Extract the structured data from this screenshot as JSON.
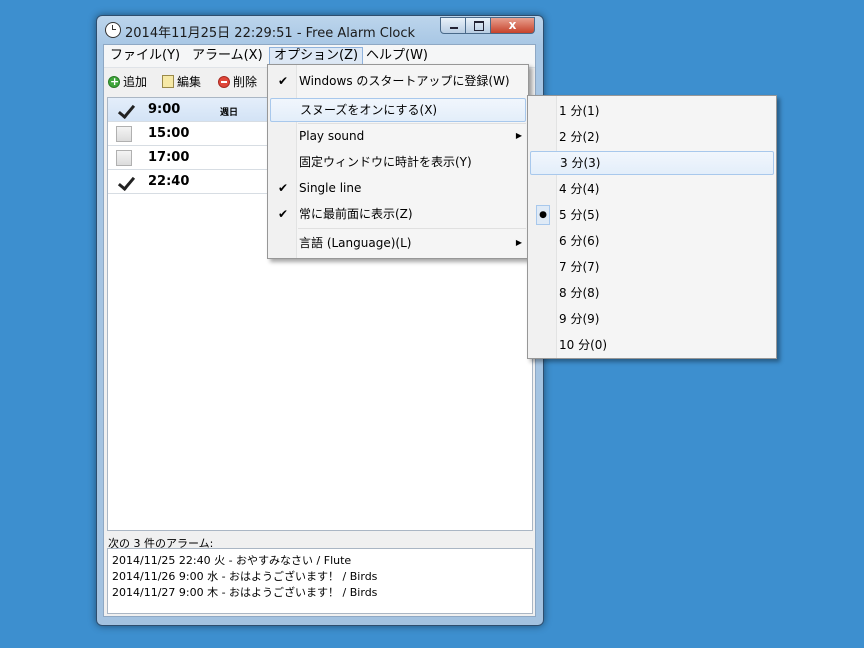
{
  "window": {
    "title": "2014年11月25日 22:29:51 - Free Alarm Clock",
    "close_label": "x"
  },
  "menubar": [
    {
      "label": "ファイル(Y)"
    },
    {
      "label": "アラーム(X)"
    },
    {
      "label": "オプション(Z)",
      "active": true
    },
    {
      "label": "ヘルプ(W)"
    }
  ],
  "toolbar": {
    "add_label": "追加",
    "edit_label": "編集",
    "delete_label": "削除"
  },
  "alarms": [
    {
      "time": "9:00",
      "enabled": true,
      "repeat": "週日",
      "selected": true
    },
    {
      "time": "15:00",
      "enabled": false,
      "repeat": ""
    },
    {
      "time": "17:00",
      "enabled": false,
      "repeat": ""
    },
    {
      "time": "22:40",
      "enabled": true,
      "repeat": ""
    }
  ],
  "next_alarms": {
    "label": "次の 3 件のアラーム:",
    "items": [
      "2014/11/25 22:40 火 - おやすみなさい / Flute",
      "2014/11/26 9:00 水 - おはようございます！ / Birds",
      "2014/11/27 9:00 木 - おはようございます！ / Birds"
    ]
  },
  "options_menu": [
    {
      "label": "Windows のスタートアップに登録(W)",
      "checked": true
    },
    {
      "label": "スヌーズをオンにする(X)",
      "checked": false,
      "highlighted": true
    },
    {
      "label": "Play sound",
      "submenu": true
    },
    {
      "label": "固定ウィンドウに時計を表示(Y)"
    },
    {
      "label": "Single line",
      "checked": true
    },
    {
      "label": "常に最前面に表示(Z)",
      "checked": true
    },
    {
      "label": "言語 (Language)(L)",
      "submenu": true
    }
  ],
  "snooze_submenu": [
    {
      "label": "1 分(1)"
    },
    {
      "label": "2 分(2)"
    },
    {
      "label": "3 分(3)",
      "highlighted": true
    },
    {
      "label": "4 分(4)"
    },
    {
      "label": "5 分(5)",
      "selected": true
    },
    {
      "label": "6 分(6)"
    },
    {
      "label": "7 分(7)"
    },
    {
      "label": "8 分(8)"
    },
    {
      "label": "9 分(9)"
    },
    {
      "label": "10 分(0)"
    }
  ],
  "icons": {
    "check": "✔",
    "bullet": "●",
    "submenu_arrow": "▶"
  }
}
